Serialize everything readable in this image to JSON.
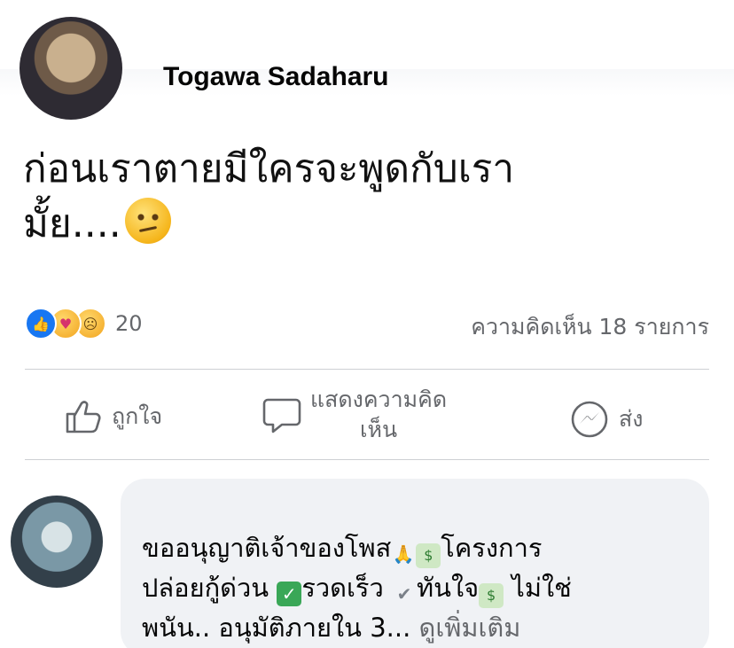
{
  "post": {
    "author": "Togawa Sadaharu",
    "text_line1": "ก่อนเราตายมีใครจะพูดกับเรา",
    "text_line2": "มั้ย....",
    "emoji": "confused-face"
  },
  "stats": {
    "reaction_count": "20",
    "reactions": [
      "like",
      "care",
      "sad"
    ],
    "comment_count": "ความคิดเห็น 18 รายการ"
  },
  "actions": {
    "like": "ถูกใจ",
    "comment_line1": "แสดงความคิด",
    "comment_line2": "เห็น",
    "send": "ส่ง"
  },
  "comment": {
    "part1": "ขออนุญาติเจ้าของโพส",
    "part2": "โครงการ",
    "part3": "ปล่อยกู้ด่วน ",
    "part4": "รวดเร็ว ",
    "part5": "ทันใจ",
    "part6": " ไม่ใช่",
    "part7": "พนัน.. อนุมัติภายใน 3...",
    "see_more": "ดูเพิ่มเติม"
  },
  "colors": {
    "brand_blue": "#1877f2",
    "secondary_text": "#65676b",
    "bubble_bg": "#f0f2f5"
  }
}
